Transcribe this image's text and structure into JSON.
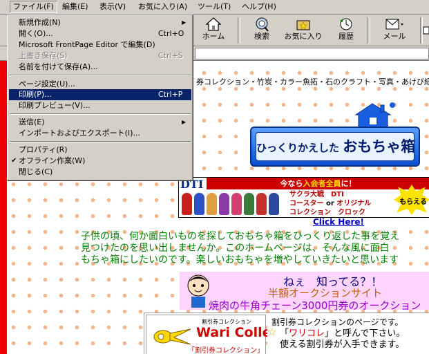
{
  "menubar": {
    "items": [
      "ファイル(F)",
      "編集(E)",
      "表示(V)",
      "お気に入り(A)",
      "ツール(T)",
      "ヘルプ(H)"
    ]
  },
  "toolbar": {
    "home": "ホーム",
    "search": "検索",
    "favorites": "お気に入り",
    "history": "履歴",
    "mail": "メール"
  },
  "file_menu": {
    "items": [
      {
        "label": "新規作成(N)",
        "submenu": true
      },
      {
        "label": "開く(O)...",
        "shortcut": "Ctrl+O"
      },
      {
        "label": "Microsoft FrontPage Editor で編集(D)"
      },
      {
        "label": "上書き保存(S)",
        "shortcut": "Ctrl+S",
        "disabled": true
      },
      {
        "label": "名前を付けて保存(A)..."
      },
      {
        "label": "ページ設定(U)..."
      },
      {
        "label": "印刷(P)...",
        "shortcut": "Ctrl+P",
        "highlighted": true
      },
      {
        "label": "印刷プレビュー(V)..."
      },
      {
        "label": "送信(E)",
        "submenu": true
      },
      {
        "label": "インポートおよびエクスポート(I)..."
      },
      {
        "label": "プロパティ(R)"
      },
      {
        "label": "オフライン作業(W)",
        "checked": true
      },
      {
        "label": "閉じる(C)"
      }
    ]
  },
  "page": {
    "topline": "券コレクション・竹炭・カラー魚拓・石のクラフト・写真・あけび細工などが",
    "logo_small": "ひっくりかえした",
    "logo_big": "おもちゃ箱",
    "banner": {
      "logo": "DTI",
      "headline_a": "今なら",
      "headline_b": "入会者全員",
      "headline_c": "に！",
      "line1": "サクラ大戦　DTI",
      "line2a": "コースター",
      "line2b": " or ",
      "line2c": "オリジナル",
      "line3": "コレクション　クロック",
      "burst": "もらえる"
    },
    "click_here": "Click Here!",
    "intro": [
      "子供の頃、何か面白いものを探しておもちゃ箱をひっくり返した事を覚え",
      "見つけたのを思い出しませんか。このホームページは、そんな風に面白",
      "もちゃ箱にしたいのです。楽しいおもちゃを増やしていきたいと思います"
    ],
    "auction": {
      "line1": "ねぇ　知ってる？！",
      "line2": "半額オークションサイト",
      "line3": "焼肉の牛角チェーン3000円券のオークション"
    },
    "wari": {
      "small": "割引券コレクション",
      "main": "Wari Colle",
      "sub": "「割引券コレクション」",
      "text1": "割引券コレクションのページです。",
      "text2a": "「",
      "text2b": "ワリコレ",
      "text2c": "」と呼んで下さい。",
      "text3": "使える割引券が入手できます。"
    }
  }
}
